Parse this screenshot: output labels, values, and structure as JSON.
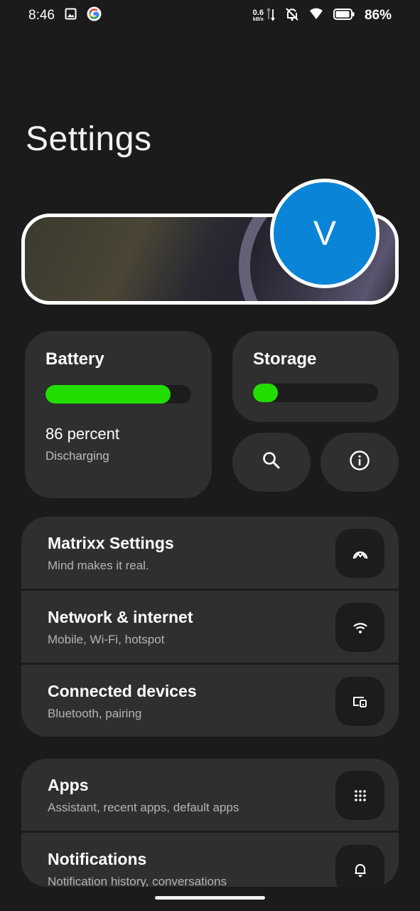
{
  "status_bar": {
    "time": "8:46",
    "net_speed_value": "0.6",
    "net_speed_unit": "kB/s",
    "battery_percent": "86%",
    "icons": [
      "gallery-icon",
      "google-icon",
      "data-arrows-icon",
      "mute-icon",
      "wifi-icon",
      "battery-icon"
    ]
  },
  "page": {
    "title": "Settings"
  },
  "profile": {
    "avatar_letter": "V"
  },
  "battery": {
    "title": "Battery",
    "level_fraction": 0.86,
    "value_text": "86 percent",
    "status": "Discharging",
    "bar_color": "#22dd00"
  },
  "storage": {
    "title": "Storage",
    "used_fraction": 0.2,
    "bar_color": "#22dd00"
  },
  "quick_buttons": [
    {
      "icon": "search-icon"
    },
    {
      "icon": "info-icon"
    }
  ],
  "groups": [
    {
      "items": [
        {
          "title": "Matrixx Settings",
          "subtitle": "Mind makes it real.",
          "icon": "matrixx-icon"
        },
        {
          "title": "Network & internet",
          "subtitle": "Mobile, Wi-Fi, hotspot",
          "icon": "wifi-icon"
        },
        {
          "title": "Connected devices",
          "subtitle": "Bluetooth, pairing",
          "icon": "devices-icon"
        }
      ]
    },
    {
      "items": [
        {
          "title": "Apps",
          "subtitle": "Assistant, recent apps, default apps",
          "icon": "apps-grid-icon"
        },
        {
          "title": "Notifications",
          "subtitle": "Notification history, conversations",
          "icon": "bell-icon"
        }
      ]
    }
  ],
  "colors": {
    "background": "#1b1b1b",
    "card": "#2f2f2f",
    "accent_green": "#22dd00",
    "avatar_blue": "#0a84d6"
  }
}
